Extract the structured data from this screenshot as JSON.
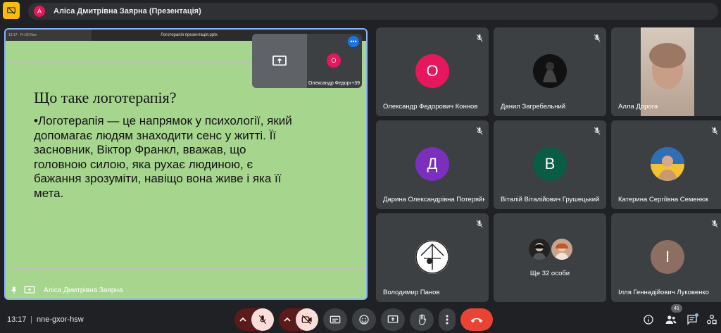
{
  "header": {
    "presenter_initial": "А",
    "title": "Аліса Дмитрівна Заярна (Презентація)"
  },
  "stage": {
    "toolbar_left": "13:17 · Fri 20 Nov",
    "file_name": "Логотерапія презентація.pptx",
    "slide_title": "Що таке логотерапія?",
    "slide_body": "•Логотерапія — це напрямок у психології, який допомагає людям знаходити сенс у житті. Її засновник, Віктор Франкл, вважав, що головною силою, яка рухає людиною, є бажання зрозуміти, навіщо вона живе і яка її мета.",
    "presenter_name": "Аліса Дмитрівна Заярна"
  },
  "self_view": {
    "avatar": "О",
    "name": "Олександр Федорович Коннов",
    "count": "+39",
    "more": "•••"
  },
  "tiles": [
    {
      "name": "Олександр Федорович Коннов",
      "initial": "О",
      "color": "#e8175d"
    },
    {
      "name": "Данил Загребельний",
      "initial": "",
      "color": "#111111"
    },
    {
      "name": "Алла Дорога",
      "initial": "",
      "color": "#c9b3a3"
    },
    {
      "name": "Дарина Олександрівна Потеряйко",
      "initial": "Д",
      "color": "#7b2fbe"
    },
    {
      "name": "Віталій Віталійович Грушецький",
      "initial": "В",
      "color": "#0b5c45"
    },
    {
      "name": "Катерина Сергіївна Семенюк",
      "initial": "",
      "color": "#2f6fb5"
    },
    {
      "name": "Володимир Панов",
      "initial": "",
      "color": "#ffffff"
    },
    {
      "name": "Ще 32 особи",
      "initial": "",
      "color": "#3c4043"
    },
    {
      "name": "Ілля Геннадійович Луковенко",
      "initial": "І",
      "color": "#8d6e63"
    }
  ],
  "bottom": {
    "time": "13:17",
    "separator": "|",
    "meeting_code": "nne-gxor-hsw",
    "people_count": "41"
  },
  "colors": {
    "accent_blue": "#8ab4f8",
    "end_call_red": "#ea4335",
    "muted_red": "#f9dedc",
    "dark_red": "#5c1a1a"
  }
}
